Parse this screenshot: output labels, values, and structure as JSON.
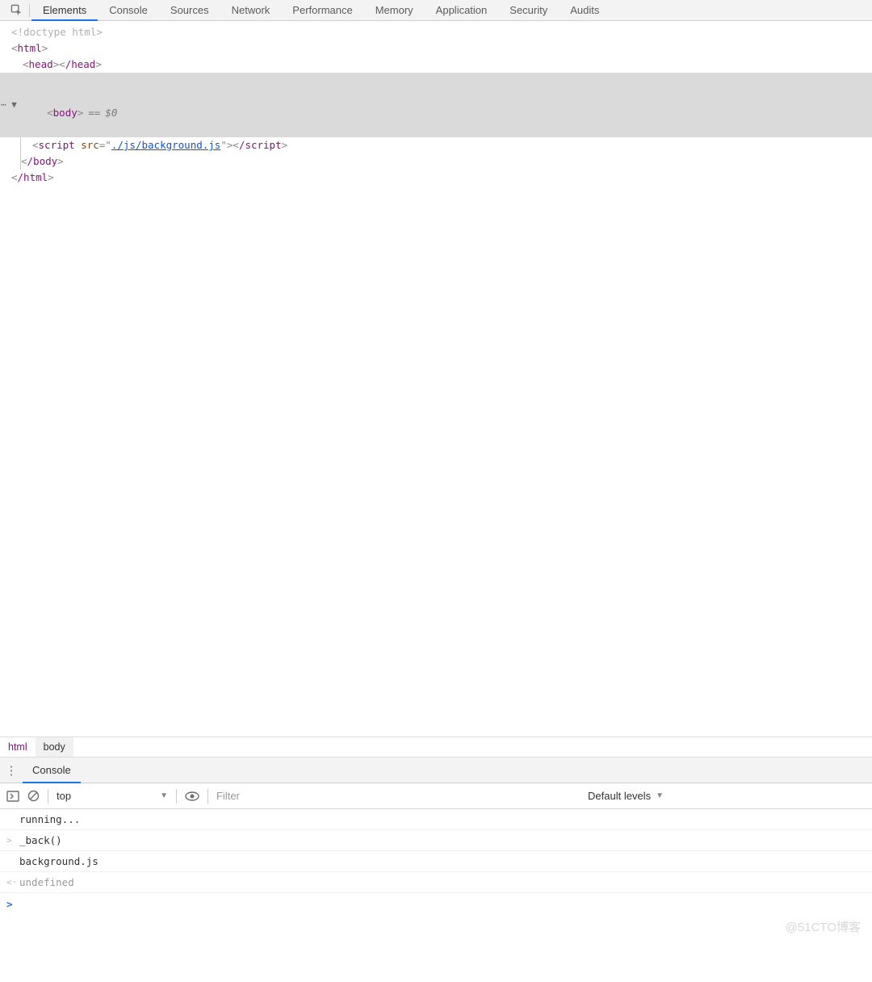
{
  "tabs": [
    "Elements",
    "Console",
    "Sources",
    "Network",
    "Performance",
    "Memory",
    "Application",
    "Security",
    "Audits"
  ],
  "active_tab": 0,
  "dom": {
    "doctype": "<!doctype html>",
    "html_open": "html",
    "head_open": "head",
    "head_close": "/head",
    "body_open": "body",
    "body_sel_eq": "==",
    "body_sel_var": "$0",
    "script_tag": "script",
    "script_attr": "src",
    "script_q": "\"",
    "script_src": "./js/background.js",
    "script_close": "/script",
    "body_close": "/body",
    "html_close": "/html",
    "gutter": "⋯ ▼"
  },
  "breadcrumb": [
    "html",
    "body"
  ],
  "breadcrumb_active": 1,
  "drawer_tab": "Console",
  "toolbar": {
    "context": "top",
    "filter_placeholder": "Filter",
    "levels": "Default levels"
  },
  "console_lines": [
    {
      "g": "",
      "t": "running...",
      "cls": "con-txt"
    },
    {
      "g": ">",
      "t": "_back()",
      "cls": "con-txt"
    },
    {
      "g": "",
      "t": "background.js",
      "cls": "con-txt"
    },
    {
      "g": "<·",
      "t": "undefined",
      "cls": "con-undef"
    }
  ],
  "watermark": "@51CTO博客"
}
